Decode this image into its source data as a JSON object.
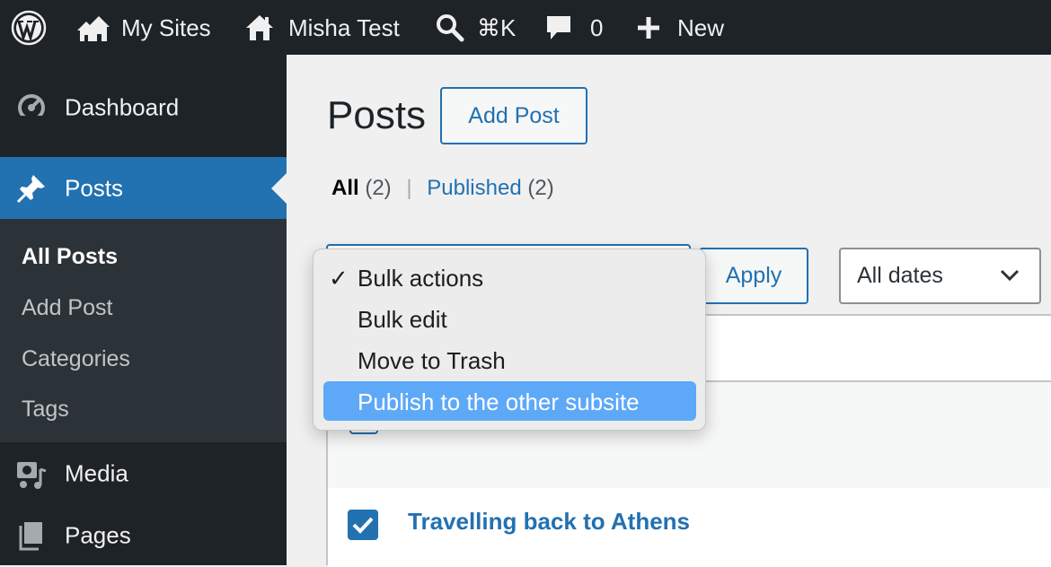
{
  "admin_bar": {
    "wp_logo_icon": "wordpress-logo-icon",
    "my_sites": "My Sites",
    "site_name": "Misha Test",
    "search_shortcut": "⌘K",
    "comments_count": "0",
    "new_label": "New"
  },
  "sidebar": {
    "dashboard": "Dashboard",
    "posts": "Posts",
    "submenu": [
      "All Posts",
      "Add Post",
      "Categories",
      "Tags"
    ],
    "media": "Media",
    "pages": "Pages",
    "active_color": "#2271b1"
  },
  "main": {
    "page_title": "Posts",
    "add_post_button": "Add Post",
    "filters": {
      "all_label": "All",
      "all_count": "(2)",
      "separator": "|",
      "published_label": "Published",
      "published_count": "(2)"
    },
    "apply_button": "Apply",
    "dates_select": "All dates",
    "rows": [
      {
        "title": "Travelling back to Athens",
        "checked": true
      }
    ]
  },
  "bulk_dropdown": {
    "check_mark": "✓",
    "options": [
      "Bulk actions",
      "Bulk edit",
      "Move to Trash",
      "Publish to the other subsite"
    ],
    "selected": "Bulk actions",
    "highlighted": "Publish to the other subsite",
    "highlight_color": "#5ea8f8"
  }
}
